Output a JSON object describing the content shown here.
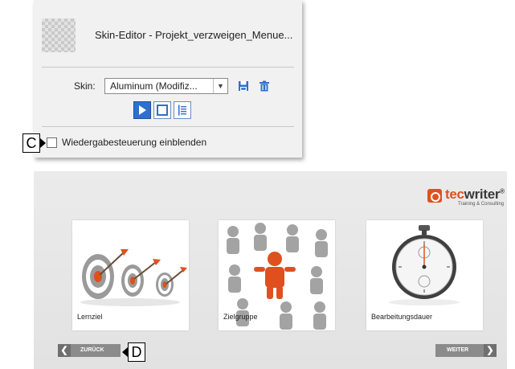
{
  "skin_editor": {
    "title": "Skin-Editor - Projekt_verzweigen_Menue...",
    "skin_label": "Skin:",
    "skin_value": "Aluminum (Modifiz...",
    "icons": {
      "save": "save-icon",
      "delete": "trash-icon",
      "playbar": "playbar-icon",
      "borders": "borders-icon",
      "toc": "toc-icon"
    },
    "checkbox_label": "Wiedergabesteuerung einblenden",
    "checkbox_checked": false
  },
  "callouts": {
    "c": "C",
    "d": "D"
  },
  "preview": {
    "logo": {
      "brand_tec": "tec",
      "brand_writer": "writer",
      "registered": "®",
      "subtitle": "Training & Consulting"
    },
    "cards": [
      {
        "label": "Lernziel",
        "image": "targets-with-arrows"
      },
      {
        "label": "Zielgruppe",
        "image": "crowd-figures"
      },
      {
        "label": "Bearbeitungsdauer",
        "image": "stopwatch"
      }
    ],
    "nav": {
      "back_label": "ZURÜCK",
      "next_label": "WEITER"
    }
  },
  "colors": {
    "accent_blue": "#2f6fd0",
    "brand_orange": "#e0501e"
  }
}
